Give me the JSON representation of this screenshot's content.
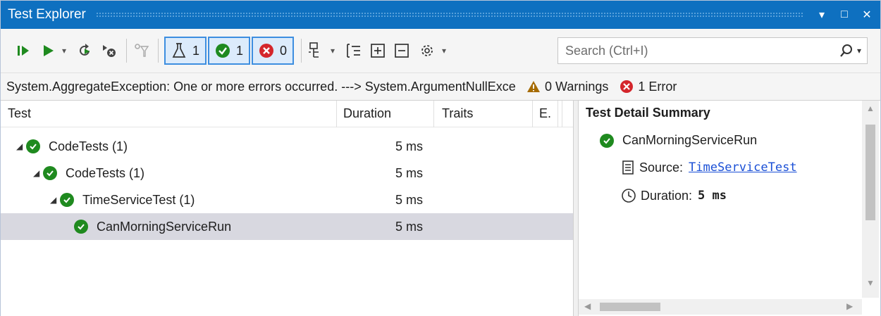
{
  "window": {
    "title": "Test Explorer",
    "pin_label": "▾",
    "maximize_label": "□",
    "close_label": "✕"
  },
  "toolbar": {
    "counters": [
      {
        "name": "total",
        "count": "1"
      },
      {
        "name": "passed",
        "count": "1"
      },
      {
        "name": "failed",
        "count": "0"
      }
    ],
    "search_placeholder": "Search (Ctrl+I)"
  },
  "infobar": {
    "message": "System.AggregateException: One or more errors occurred. ---> System.ArgumentNullExceptio",
    "warnings": "0 Warnings",
    "errors": "1 Error"
  },
  "grid": {
    "columns": [
      "Test",
      "Duration",
      "Traits",
      "E."
    ],
    "rows": [
      {
        "name": "CodeTests (1)",
        "duration": "5 ms",
        "level": 0
      },
      {
        "name": "CodeTests (1)",
        "duration": "5 ms",
        "level": 1
      },
      {
        "name": "TimeServiceTest (1)",
        "duration": "5 ms",
        "level": 2
      },
      {
        "name": "CanMorningServiceRun",
        "duration": "5 ms",
        "level": 3
      }
    ]
  },
  "detail": {
    "title": "Test Detail Summary",
    "test_name": "CanMorningServiceRun",
    "source_label": "Source:",
    "source_value": "TimeServiceTest",
    "duration_label": "Duration:",
    "duration_value": "5 ms"
  },
  "colors": {
    "accent": "#0e70c0",
    "pass": "#1f8a1f",
    "fail": "#d4262c",
    "link": "#1a4fd6"
  }
}
